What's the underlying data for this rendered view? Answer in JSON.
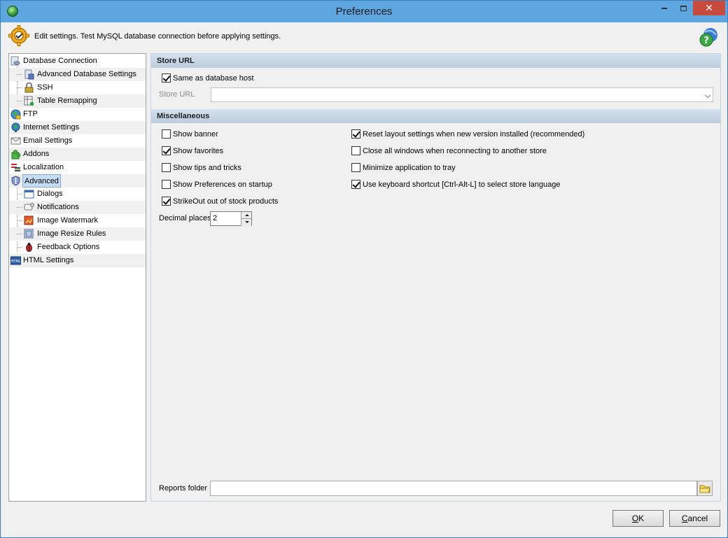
{
  "window": {
    "title": "Preferences"
  },
  "infobar": {
    "text": "Edit settings. Test MySQL database connection before applying settings."
  },
  "tree": {
    "items": [
      {
        "label": "Database Connection",
        "icon": "database-connection-icon",
        "level": 0
      },
      {
        "label": "Advanced Database Settings",
        "icon": "advanced-database-icon",
        "level": 1
      },
      {
        "label": "SSH",
        "icon": "lock-icon",
        "level": 1
      },
      {
        "label": "Table Remapping",
        "icon": "table-remap-icon",
        "level": 1
      },
      {
        "label": "FTP",
        "icon": "ftp-globe-icon",
        "level": 0
      },
      {
        "label": "Internet Settings",
        "icon": "internet-globe-icon",
        "level": 0
      },
      {
        "label": "Email Settings",
        "icon": "envelope-icon",
        "level": 0
      },
      {
        "label": "Addons",
        "icon": "puzzle-icon",
        "level": 0
      },
      {
        "label": "Localization",
        "icon": "flags-icon",
        "level": 0
      },
      {
        "label": "Advanced",
        "icon": "shield-icon",
        "level": 0,
        "selected": true
      },
      {
        "label": "Dialogs",
        "icon": "dialog-window-icon",
        "level": 1
      },
      {
        "label": "Notifications",
        "icon": "notification-icon",
        "level": 1
      },
      {
        "label": "Image Watermark",
        "icon": "image-watermark-icon",
        "level": 1
      },
      {
        "label": "Image Resize Rules",
        "icon": "image-resize-icon",
        "level": 1
      },
      {
        "label": "Feedback Options",
        "icon": "bug-icon",
        "level": 1
      },
      {
        "label": "HTML Settings",
        "icon": "html-icon",
        "level": 0
      }
    ]
  },
  "store_url": {
    "header": "Store URL",
    "same_as_host_label": "Same as database host",
    "same_as_host_checked": true,
    "store_url_label": "Store URL",
    "store_url_value": ""
  },
  "misc": {
    "header": "Miscellaneous",
    "left": [
      {
        "label": "Show banner",
        "checked": false
      },
      {
        "label": "Show favorites",
        "checked": true
      },
      {
        "label": "Show tips and tricks",
        "checked": false
      },
      {
        "label": "Show Preferences on startup",
        "checked": false
      },
      {
        "label": "StrikeOut out of stock products",
        "checked": true
      }
    ],
    "right": [
      {
        "label": "Reset layout settings when new version installed (recommended)",
        "checked": true
      },
      {
        "label": "Close all windows when reconnecting to another store",
        "checked": false
      },
      {
        "label": "Minimize application to tray",
        "checked": false
      },
      {
        "label": "Use keyboard shortcut [Ctrl-Alt-L] to select store language",
        "checked": true
      }
    ],
    "decimal_label": "Decimal places",
    "decimal_value": "2"
  },
  "reports": {
    "label": "Reports folder",
    "value": ""
  },
  "buttons": {
    "ok_mnemonic": "O",
    "ok_rest": "K",
    "cancel_mnemonic": "C",
    "cancel_rest": "ancel"
  }
}
